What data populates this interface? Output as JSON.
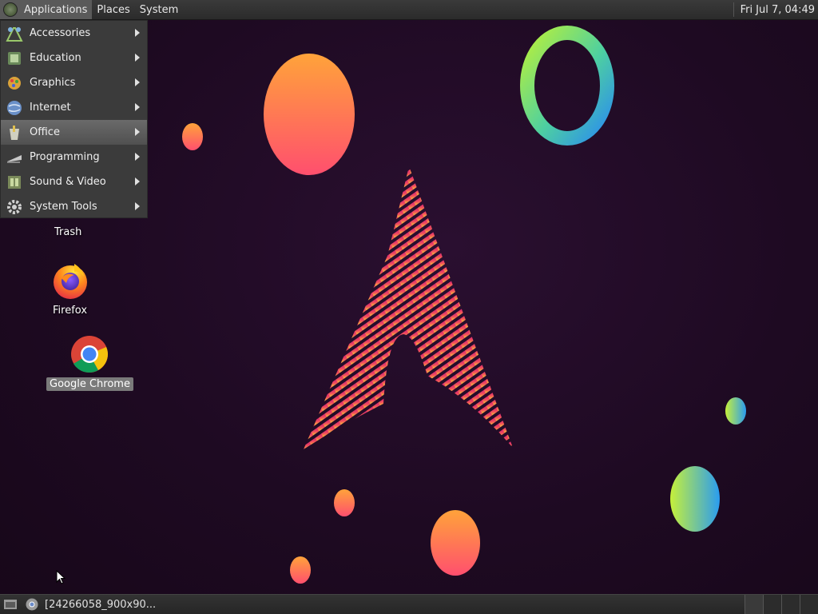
{
  "top_panel": {
    "applications": "Applications",
    "places": "Places",
    "system": "System",
    "clock": "Fri Jul  7, 04:49"
  },
  "app_menu": {
    "items": [
      {
        "label": "Accessories",
        "icon": "accessories-icon"
      },
      {
        "label": "Education",
        "icon": "education-icon"
      },
      {
        "label": "Graphics",
        "icon": "graphics-icon"
      },
      {
        "label": "Internet",
        "icon": "internet-icon"
      },
      {
        "label": "Office",
        "icon": "office-icon",
        "highlighted": true
      },
      {
        "label": "Programming",
        "icon": "programming-icon"
      },
      {
        "label": "Sound & Video",
        "icon": "sound-video-icon"
      },
      {
        "label": "System Tools",
        "icon": "system-tools-icon"
      }
    ]
  },
  "desktop": {
    "icons": [
      {
        "label": "Trash",
        "icon": "trash-icon"
      },
      {
        "label": "Firefox",
        "icon": "firefox-icon"
      },
      {
        "label": "Google Chrome",
        "icon": "chrome-icon",
        "selected": true
      }
    ]
  },
  "taskbar": {
    "task_label": "[24266058_900x90..."
  },
  "colors": {
    "panel_bg": "#2b2b2b",
    "menu_bg": "#3b3b3b",
    "menu_highlight": "#5f5f5f",
    "desktop_bg": "#1e0a22"
  }
}
